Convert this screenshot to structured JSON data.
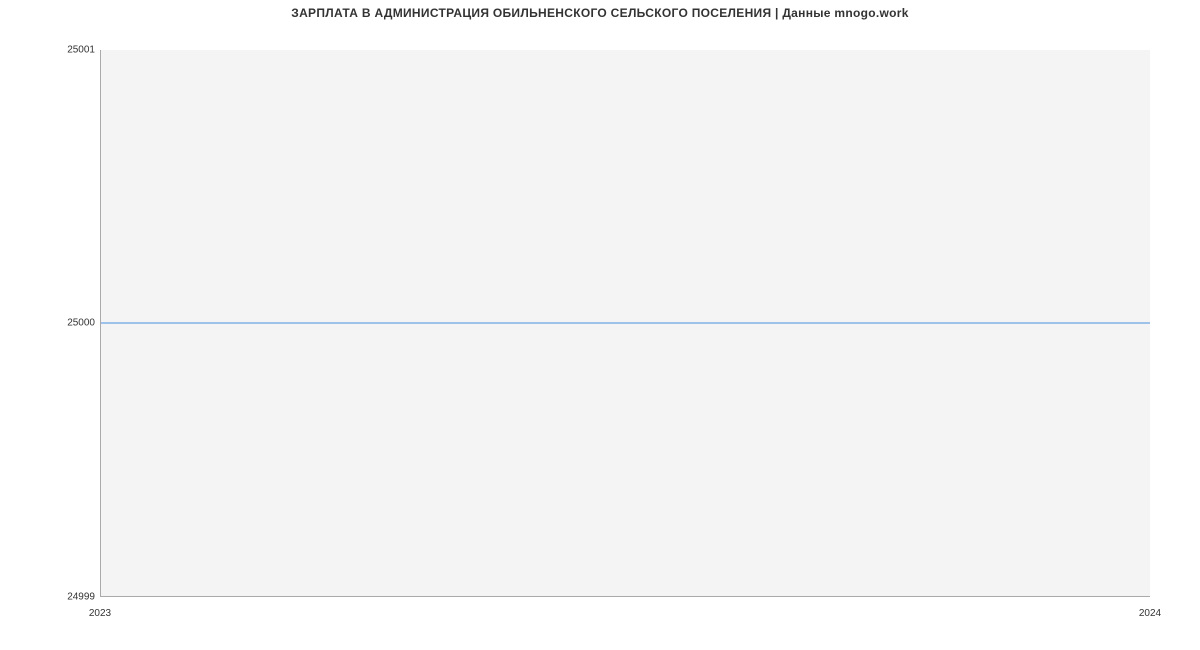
{
  "chart_data": {
    "type": "line",
    "title": "ЗАРПЛАТА В АДМИНИСТРАЦИЯ ОБИЛЬНЕНСКОГО СЕЛЬСКОГО ПОСЕЛЕНИЯ | Данные mnogo.work",
    "x": [
      2023,
      2024
    ],
    "series": [
      {
        "name": "salary",
        "values": [
          25000,
          25000
        ]
      }
    ],
    "xlabel": "",
    "ylabel": "",
    "ylim": [
      24999,
      25001
    ],
    "y_ticks": [
      24999,
      25000,
      25001
    ],
    "x_ticks": [
      2023,
      2024
    ]
  },
  "y_labels": {
    "top": "25001",
    "mid": "25000",
    "bot": "24999"
  },
  "x_labels": {
    "left": "2023",
    "right": "2024"
  }
}
